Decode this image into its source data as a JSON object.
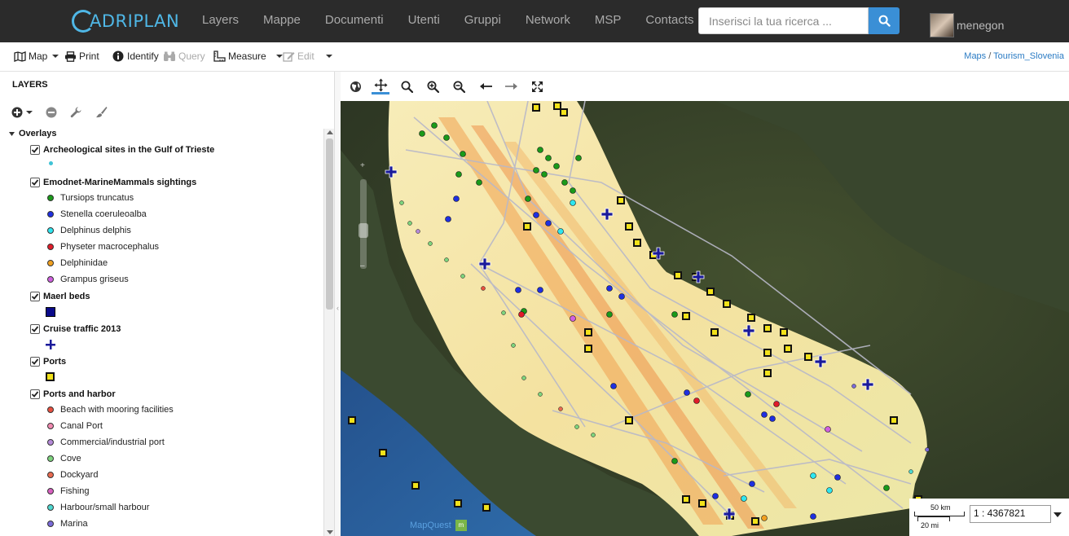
{
  "app": {
    "logo_text": "ADRIPLAN",
    "nav": [
      "Layers",
      "Mappe",
      "Documenti",
      "Utenti",
      "Gruppi",
      "Network",
      "MSP",
      "Contacts"
    ],
    "search_placeholder": "Inserisci la tua ricerca ...",
    "username": "menegon"
  },
  "toolbar": {
    "map": "Map",
    "print": "Print",
    "identify": "Identify",
    "query": "Query",
    "measure": "Measure",
    "edit": "Edit"
  },
  "breadcrumb": {
    "root": "Maps",
    "sep": " / ",
    "current": "Tourism_Slovenia"
  },
  "layers_panel": {
    "title": "LAYERS",
    "root_group": "Overlays",
    "groups": [
      {
        "label": "Archeological sites in the Gulf of Trieste",
        "checked": true,
        "legend": [
          {
            "label": "",
            "color": "#3fc3d6",
            "shape": "small-dot"
          }
        ]
      },
      {
        "label": "Emodnet-MarineMammals sightings",
        "checked": true,
        "legend": [
          {
            "label": "Tursiops truncatus",
            "color": "#1a9a1a",
            "shape": "dot"
          },
          {
            "label": "Stenella coeruleoalba",
            "color": "#1f2fe0",
            "shape": "dot"
          },
          {
            "label": "Delphinus delphis",
            "color": "#2ee6f0",
            "shape": "dot"
          },
          {
            "label": "Physeter macrocephalus",
            "color": "#e01c2a",
            "shape": "dot"
          },
          {
            "label": "Delphinidae",
            "color": "#f0a020",
            "shape": "dot"
          },
          {
            "label": "Grampus griseus",
            "color": "#d060e0",
            "shape": "dot"
          }
        ]
      },
      {
        "label": "Maerl beds",
        "checked": true,
        "legend": [
          {
            "label": "",
            "color": "#0a0a8a",
            "shape": "square"
          }
        ]
      },
      {
        "label": "Cruise traffic 2013",
        "checked": true,
        "legend": [
          {
            "label": "",
            "color": "#1a1a9a",
            "shape": "cross"
          }
        ]
      },
      {
        "label": "Ports",
        "checked": true,
        "legend": [
          {
            "label": "",
            "color": "#f2e21a",
            "shape": "port-square"
          }
        ]
      },
      {
        "label": "Ports and harbor",
        "checked": true,
        "legend": [
          {
            "label": "Beach with mooring facilities",
            "color": "#e85040",
            "shape": "dot"
          },
          {
            "label": "Canal Port",
            "color": "#f08ab0",
            "shape": "dot"
          },
          {
            "label": "Commercial/industrial port",
            "color": "#b58ad8",
            "shape": "dot"
          },
          {
            "label": "Cove",
            "color": "#7ed47e",
            "shape": "dot"
          },
          {
            "label": "Dockyard",
            "color": "#e86a50",
            "shape": "dot"
          },
          {
            "label": "Fishing",
            "color": "#d860c0",
            "shape": "dot"
          },
          {
            "label": "Harbour/small harbour",
            "color": "#4fd8d0",
            "shape": "dot"
          },
          {
            "label": "Marina",
            "color": "#7a6ad8",
            "shape": "dot"
          }
        ]
      }
    ]
  },
  "map": {
    "scale_km": "50 km",
    "scale_mi": "20 mi",
    "scale_value": "1 : 4367821",
    "attribution": "MapQuest",
    "mq_logo": "m"
  }
}
